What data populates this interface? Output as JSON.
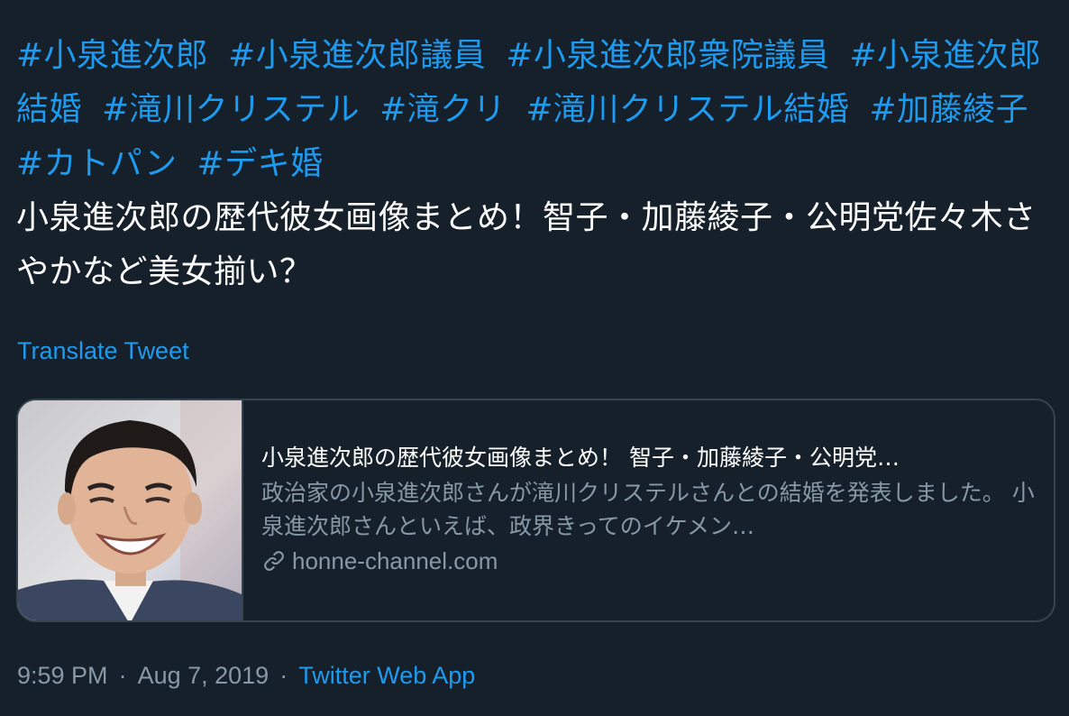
{
  "tweet": {
    "hashtags": [
      "#小泉進次郎",
      "#小泉進次郎議員",
      "#小泉進次郎衆院議員",
      "#小泉進次郎結婚",
      "#滝川クリステル",
      "#滝クリ",
      "#滝川クリステル結婚",
      "#加藤綾子",
      "#カトパン",
      "#デキ婚"
    ],
    "text": "小泉進次郎の歴代彼女画像まとめ！智子・加藤綾子・公明党佐々木さやかなど美女揃い？",
    "translate_label": "Translate Tweet"
  },
  "card": {
    "image_icon": "portrait-photo",
    "title": "小泉進次郎の歴代彼女画像まとめ！ 智子・加藤綾子・公明党…",
    "description": "政治家の小泉進次郎さんが滝川クリステルさんとの結婚を発表しました。 小泉進次郎さんといえば、政界きってのイケメン…",
    "domain_icon": "link-icon",
    "domain": "honne-channel.com"
  },
  "meta": {
    "time": "9:59 PM",
    "separator": "·",
    "date": "Aug 7, 2019",
    "source": "Twitter Web App"
  },
  "colors": {
    "background": "#15202b",
    "accent": "#1d9bf0",
    "secondary_text": "#8899a6",
    "border": "#38444d"
  }
}
